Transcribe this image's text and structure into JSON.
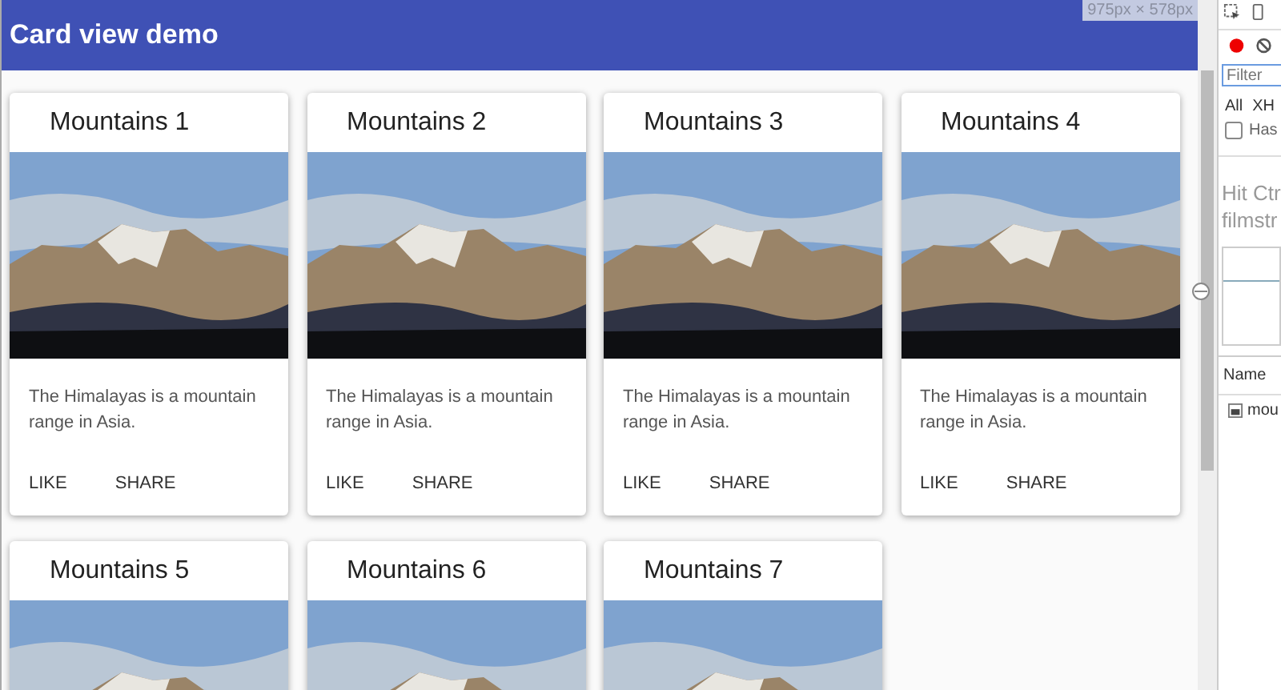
{
  "app_bar": {
    "title": "Card view demo"
  },
  "cards": [
    {
      "title": "Mountains 1",
      "description": "The Himalayas is a mountain range in Asia.",
      "actions": [
        "LIKE",
        "SHARE"
      ]
    },
    {
      "title": "Mountains 2",
      "description": "The Himalayas is a mountain range in Asia.",
      "actions": [
        "LIKE",
        "SHARE"
      ]
    },
    {
      "title": "Mountains 3",
      "description": "The Himalayas is a mountain range in Asia.",
      "actions": [
        "LIKE",
        "SHARE"
      ]
    },
    {
      "title": "Mountains 4",
      "description": "The Himalayas is a mountain range in Asia.",
      "actions": [
        "LIKE",
        "SHARE"
      ]
    },
    {
      "title": "Mountains 5"
    },
    {
      "title": "Mountains 6"
    },
    {
      "title": "Mountains 7"
    }
  ],
  "viewport_size": "975px × 578px",
  "devtools": {
    "filter": {
      "placeholder": "Filter"
    },
    "type_tabs": [
      "All",
      "XH"
    ],
    "checkbox": {
      "label": "Has",
      "checked": false
    },
    "hint_lines": [
      "Hit Ctr",
      "filmstr"
    ],
    "table": {
      "column": "Name",
      "rows": [
        "mou"
      ]
    }
  }
}
